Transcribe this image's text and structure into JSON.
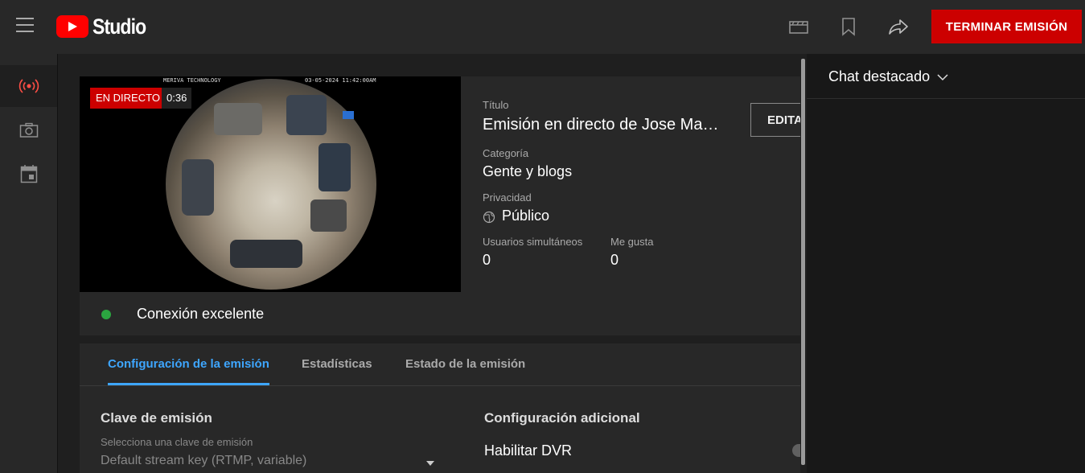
{
  "topbar": {
    "logo_text": "Studio",
    "end_stream_label": "TERMINAR EMISIÓN"
  },
  "rail": {
    "items": [
      {
        "icon": "live-icon",
        "active": true
      },
      {
        "icon": "camera-icon",
        "active": false
      },
      {
        "icon": "calendar-icon",
        "active": false
      }
    ]
  },
  "preview": {
    "overlay_left": "MERIVA TECHNOLOGY",
    "overlay_right": "03-05-2024 11:42:00AM",
    "live_label": "EN DIRECTO",
    "elapsed": "0:36"
  },
  "info": {
    "title_label": "Título",
    "title_value": "Emisión en directo de Jose Ma…",
    "category_label": "Categoría",
    "category_value": "Gente y blogs",
    "privacy_label": "Privacidad",
    "privacy_value": "Público",
    "viewers_label": "Usuarios simultáneos",
    "viewers_value": "0",
    "likes_label": "Me gusta",
    "likes_value": "0",
    "edit_label": "EDITAR"
  },
  "connection": {
    "status": "Conexión excelente",
    "status_color": "#2ba640"
  },
  "tabs": [
    {
      "label": "Configuración de la emisión",
      "active": true
    },
    {
      "label": "Estadísticas",
      "active": false
    },
    {
      "label": "Estado de la emisión",
      "active": false
    }
  ],
  "settings": {
    "stream_key_heading": "Clave de emisión",
    "stream_key_hint": "Selecciona una clave de emisión",
    "stream_key_value": "Default stream key (RTMP, variable)",
    "additional_heading": "Configuración adicional",
    "dvr_label": "Habilitar DVR"
  },
  "chat": {
    "title": "Chat destacado"
  },
  "colors": {
    "accent_blue": "#3ea6ff",
    "live_red": "#cc0000",
    "brand_red": "#ff0000"
  }
}
